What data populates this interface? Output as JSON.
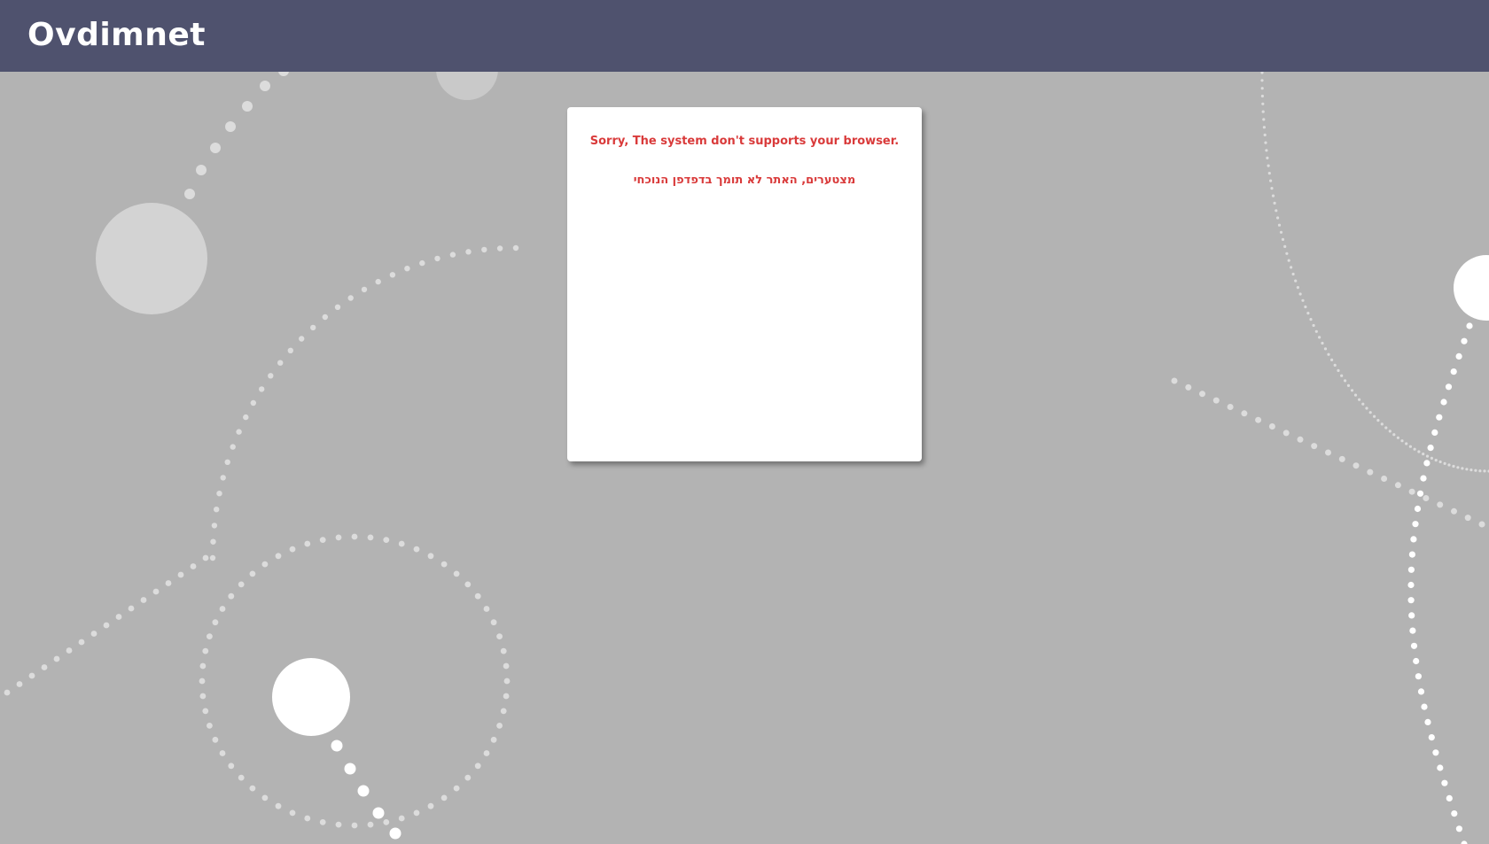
{
  "header": {
    "brand": "Ovdimnet",
    "background": "#4f526e"
  },
  "card": {
    "message_en": "Sorry, The system don't supports your browser.",
    "message_he": "מצטערים, האתר לא תומך בדפדפן הנוכחי",
    "message_color": "#d93a3a"
  },
  "page": {
    "background": "#b3b3b3"
  }
}
